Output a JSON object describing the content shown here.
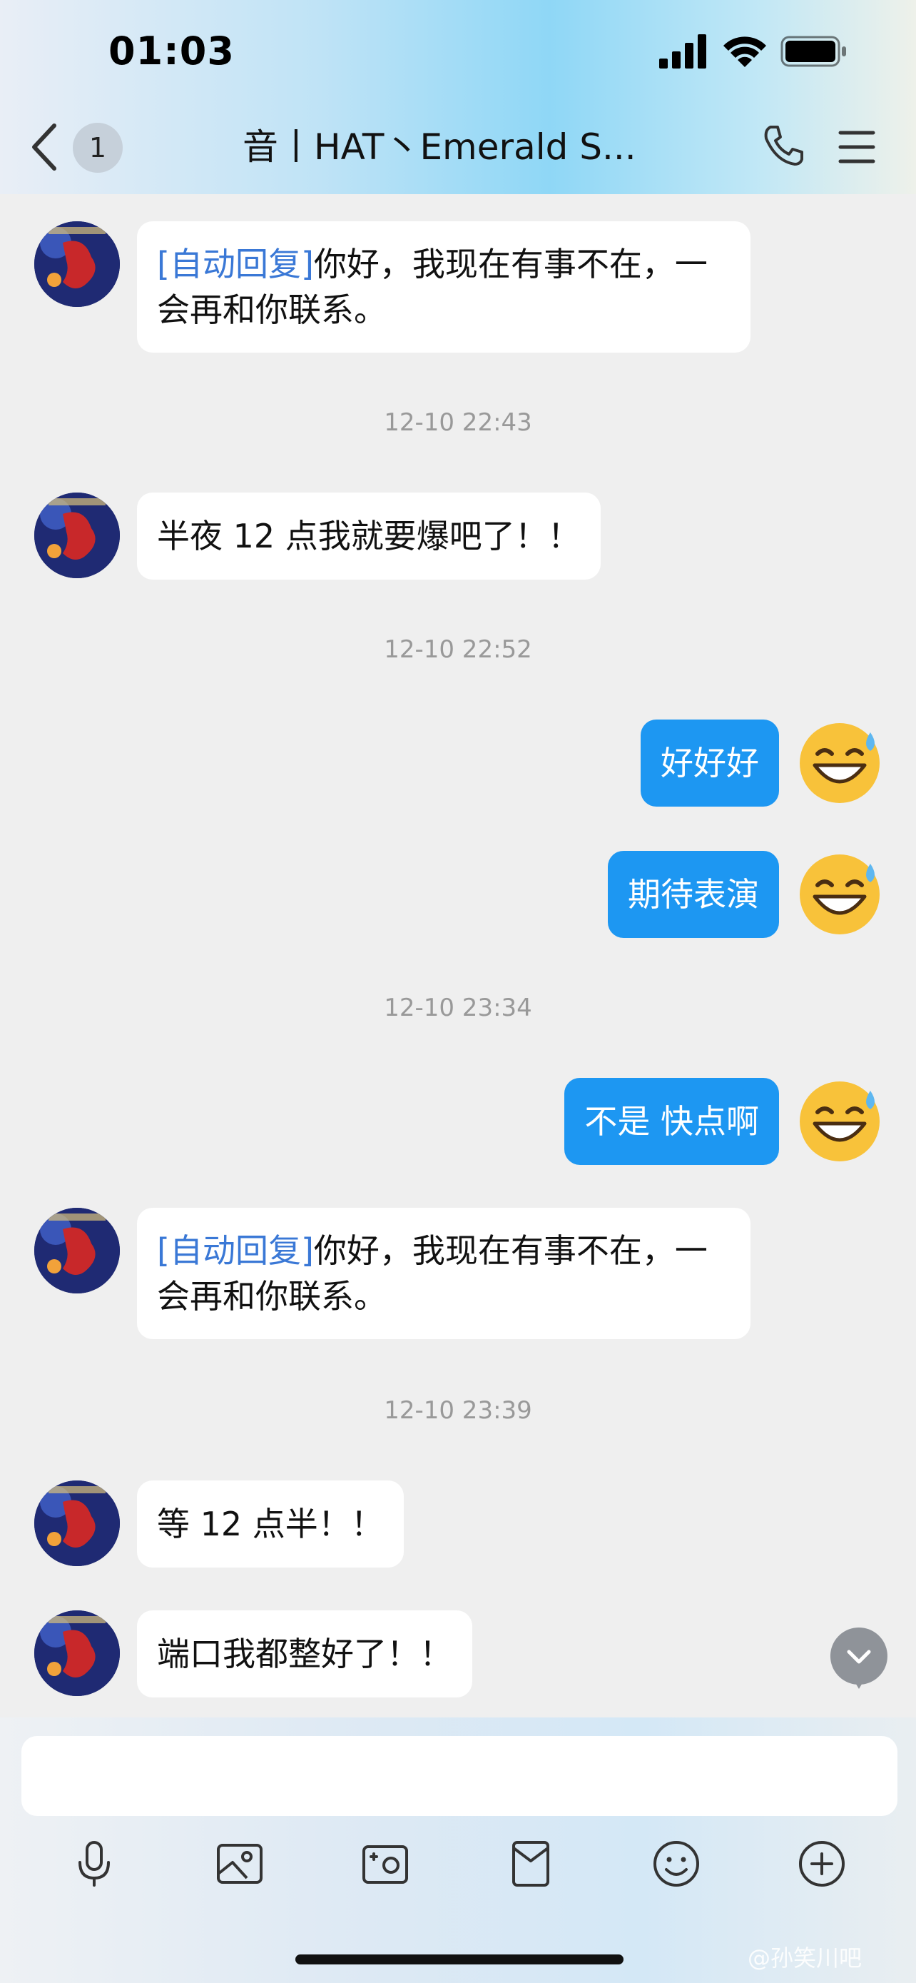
{
  "status_bar": {
    "time": "01:03"
  },
  "header": {
    "unread_count": "1",
    "title": "音丨HAT丶Emerald S..."
  },
  "messages": {
    "m1": {
      "tag": "[自动回复]",
      "line1": "你好，我现在有事不在，一",
      "line2": "会再和你联系。"
    },
    "ts1": "12-10 22:43",
    "m2": {
      "text": "半夜 12 点我就要爆吧了！！"
    },
    "ts2": "12-10 22:52",
    "m3": {
      "text": "好好好"
    },
    "m4": {
      "text": "期待表演"
    },
    "ts3": "12-10 23:34",
    "m5": {
      "text": "不是 快点啊"
    },
    "m6": {
      "tag": "[自动回复]",
      "line1": "你好，我现在有事不在，一",
      "line2": "会再和你联系。"
    },
    "ts4": "12-10 23:39",
    "m7": {
      "text": "等 12 点半！！"
    },
    "m8": {
      "text": "端口我都整好了！！"
    }
  },
  "composer": {
    "input_value": ""
  },
  "watermark": "@孙笑川吧",
  "colors": {
    "outgoing_bubble": "#1d97f2",
    "auto_reply_tag": "#3a78d6",
    "timestamp": "#999999"
  }
}
